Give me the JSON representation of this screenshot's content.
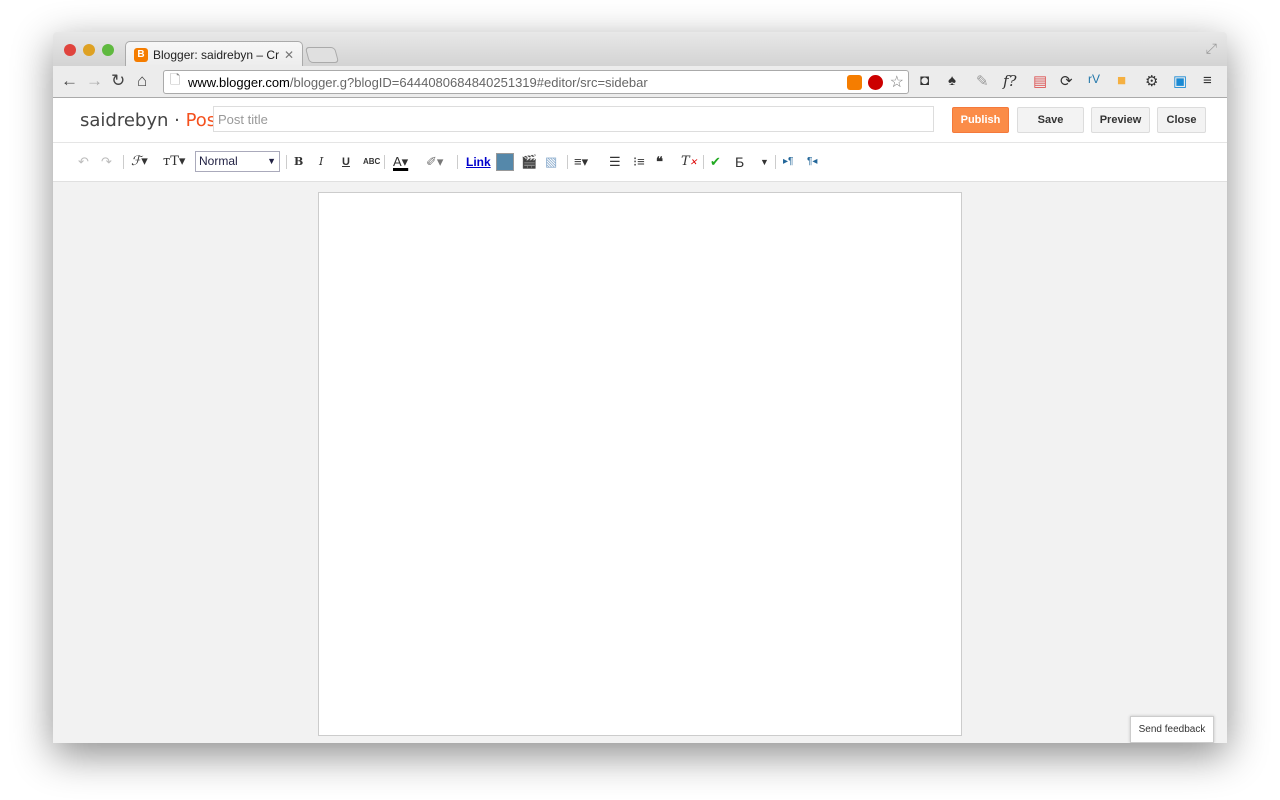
{
  "browser": {
    "tab_title": "Blogger: saidrebyn – Create",
    "url_host": "www.blogger.com",
    "url_path": "/blogger.g?blogID=6444080684840251319#editor/src=sidebar"
  },
  "header": {
    "blog_name": "saidrebyn",
    "separator": " · ",
    "page_type": "Post",
    "title_placeholder": "Post title",
    "publish": "Publish",
    "save": "Save",
    "preview": "Preview",
    "close": "Close"
  },
  "toolbar": {
    "format_value": "Normal",
    "link": "Link"
  },
  "colors": {
    "accent": "#fb8c48",
    "post_label": "#f4511e"
  },
  "footer": {
    "feedback": "Send feedback"
  }
}
